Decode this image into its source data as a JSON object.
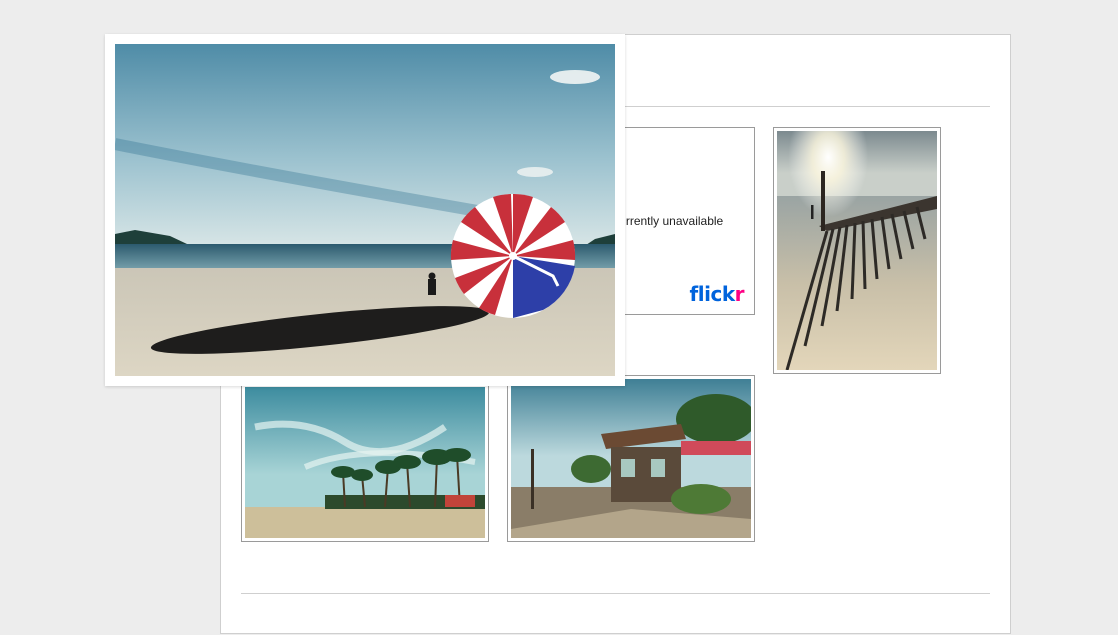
{
  "gallery": {
    "unavailable_text": "This photo is currently unavailable",
    "flickr_logo": {
      "part1": "flick",
      "part2": "r"
    },
    "thumbnails": [
      {
        "scene": "pier-shadows-sunset"
      },
      {
        "scene": "palm-beach"
      },
      {
        "scene": "beach-shack"
      }
    ]
  },
  "lightbox": {
    "scene": "parachute-on-beach"
  },
  "colors": {
    "flickr_blue": "#0063dc",
    "flickr_pink": "#ff0084",
    "page_bg": "#ededed"
  }
}
